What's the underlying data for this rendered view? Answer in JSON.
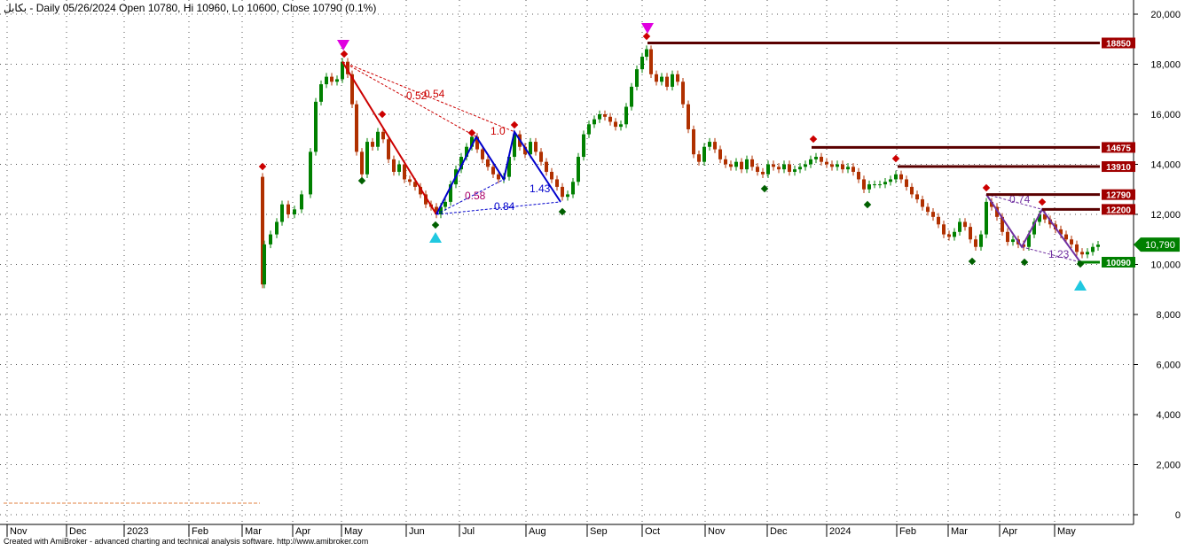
{
  "header": {
    "title": "بکابل - Daily 05/26/2024 Open 10780, Hi 10960, Lo 10600, Close 10790 (0.1%)"
  },
  "footer": {
    "credit": "Created with AmiBroker - advanced charting and technical analysis software. http://www.amibroker.com"
  },
  "chart_data": {
    "type": "candlestick",
    "y_ticks": [
      "0",
      "2,000",
      "4,000",
      "6,000",
      "8,000",
      "10,000",
      "12,000",
      "14,000",
      "16,000",
      "18,000",
      "20,000"
    ],
    "x_ticks": [
      "Nov",
      "Dec",
      "2023",
      "Feb",
      "Mar",
      "Apr",
      "May",
      "Jun",
      "Jul",
      "Aug",
      "Sep",
      "Oct",
      "Nov",
      "Dec",
      "2024",
      "Feb",
      "Mar",
      "Apr",
      "May"
    ],
    "ylim": [
      0,
      20000
    ],
    "grid": true,
    "last_price": {
      "label": "10,790",
      "value": 10790,
      "color": "#008000"
    },
    "levels": [
      {
        "label": "18850",
        "value": 18850,
        "color": "#a00000"
      },
      {
        "label": "14675",
        "value": 14675,
        "color": "#a00000"
      },
      {
        "label": "13910",
        "value": 13910,
        "color": "#a00000"
      },
      {
        "label": "12790",
        "value": 12790,
        "color": "#a00000"
      },
      {
        "label": "12200",
        "value": 12200,
        "color": "#a00000"
      },
      {
        "label": "10090",
        "value": 10090,
        "color": "#008000"
      }
    ],
    "pattern_labels": [
      "0.52",
      "0.54",
      "1.0",
      "0.58",
      "1.43",
      "0.84",
      "0.74",
      "1.23"
    ],
    "colors": {
      "up": "#008000",
      "down": "#b03000",
      "pattern_red": "#cc0000",
      "pattern_blue": "#0000cc",
      "pattern_purple": "#7030a0"
    }
  }
}
